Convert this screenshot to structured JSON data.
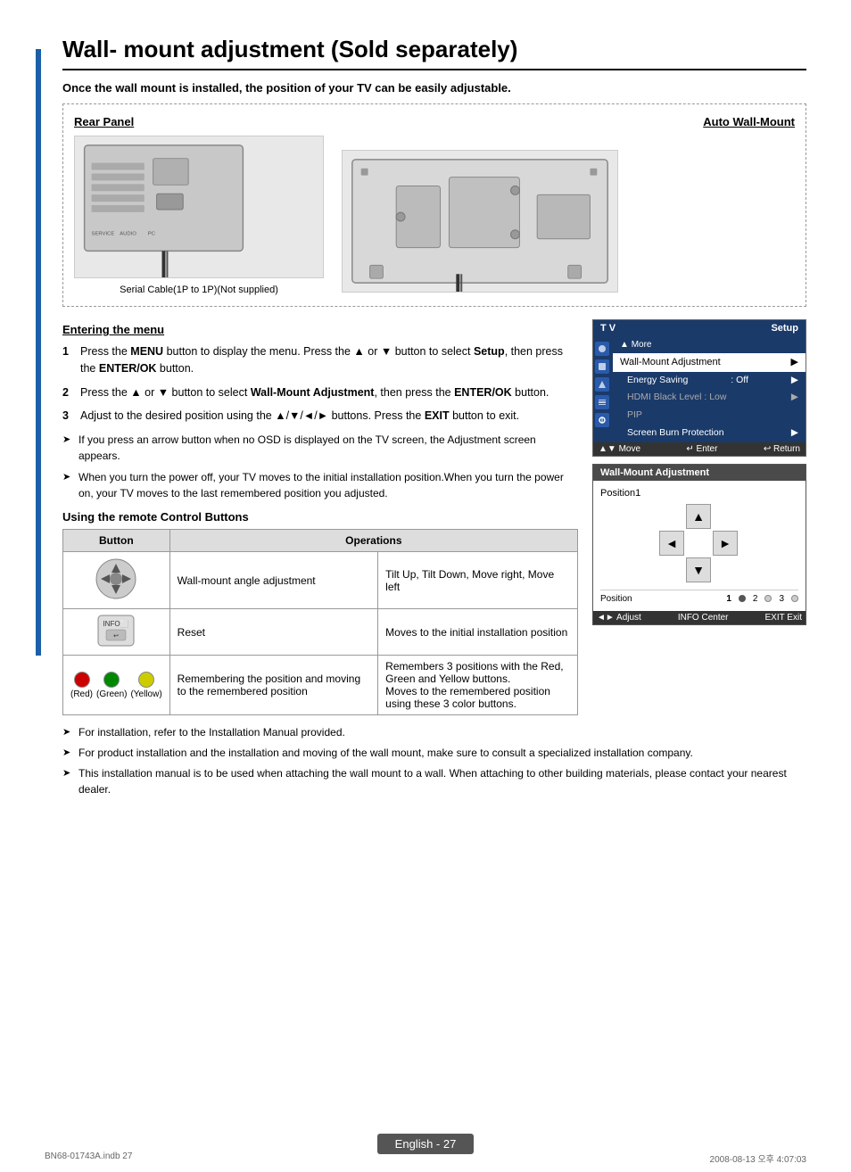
{
  "page": {
    "title": "Wall- mount adjustment (Sold separately)",
    "subtitle": "Once the wall mount is installed, the position of your TV can be easily adjustable.",
    "diagram": {
      "label_left": "Rear Panel",
      "label_right": "Auto Wall-Mount",
      "cable_label": "Serial Cable(1P to 1P)(Not supplied)"
    },
    "entering_menu": {
      "heading": "Entering the menu",
      "steps": [
        {
          "num": "1",
          "text": "Press the MENU button to display the menu. Press the ▲ or ▼ button to select Setup, then press the ENTER/OK button."
        },
        {
          "num": "2",
          "text": "Press the ▲ or ▼ button to select Wall-Mount Adjustment, then press the ENTER/OK button."
        },
        {
          "num": "3",
          "text": "Adjust to the desired position using the ▲/▼/◄/► buttons. Press the EXIT button to exit."
        }
      ],
      "notes": [
        "If you press an arrow button when no OSD is displayed on the TV screen, the Adjustment screen appears.",
        "When you turn the power off, your TV moves to the initial installation position.When you turn the power on, your TV moves to the last remembered position you adjusted."
      ]
    },
    "remote_control": {
      "heading": "Using the remote Control Buttons",
      "col_button": "Button",
      "col_operations": "Operations",
      "rows": [
        {
          "button_type": "nav-cross",
          "op1": "Wall-mount angle adjustment",
          "op2": "Tilt Up, Tilt Down, Move right, Move left"
        },
        {
          "button_type": "info-reset",
          "op1": "Reset",
          "op2": "Moves to the initial installation position"
        },
        {
          "button_type": "color-buttons",
          "op1": "Remembering the position and moving to the remembered position",
          "op2": "Remembers 3 positions with the Red, Green and Yellow buttons.\nMoves to the remembered position using these 3 color buttons."
        }
      ]
    },
    "tv_ui": {
      "header_left": "T V",
      "header_right": "Setup",
      "menu_item_more": "More",
      "menu_item_wma": "Wall-Mount Adjustment",
      "menu_item_energy": "Energy Saving",
      "menu_item_energy_val": ": Off",
      "menu_item_hdmi": "HDMI Black Level : Low",
      "menu_item_pip": "PIP",
      "menu_item_sbp": "Screen Burn Protection",
      "footer_move": "▲▼ Move",
      "footer_enter": "↵ Enter",
      "footer_return": "↩ Return"
    },
    "wall_adj": {
      "header": "Wall-Mount Adjustment",
      "pos_label": "Position1",
      "position_label": "Position",
      "pos_numbers": [
        "1",
        "2",
        "3"
      ],
      "footer_adjust": "◄► Adjust",
      "footer_center": "INFO Center",
      "footer_exit": "EXIT Exit"
    },
    "bottom_notes": [
      "For installation, refer to the Installation Manual provided.",
      "For product installation and the installation and moving of the wall mount, make sure to consult a specialized installation company.",
      "This installation manual is to be used when attaching the wall mount to a wall. When attaching to other building materials, please contact your nearest dealer."
    ],
    "page_number": "English - 27",
    "footer_left": "BN68-01743A.indb   27",
    "footer_right": "2008-08-13   오후 4:07:03"
  }
}
